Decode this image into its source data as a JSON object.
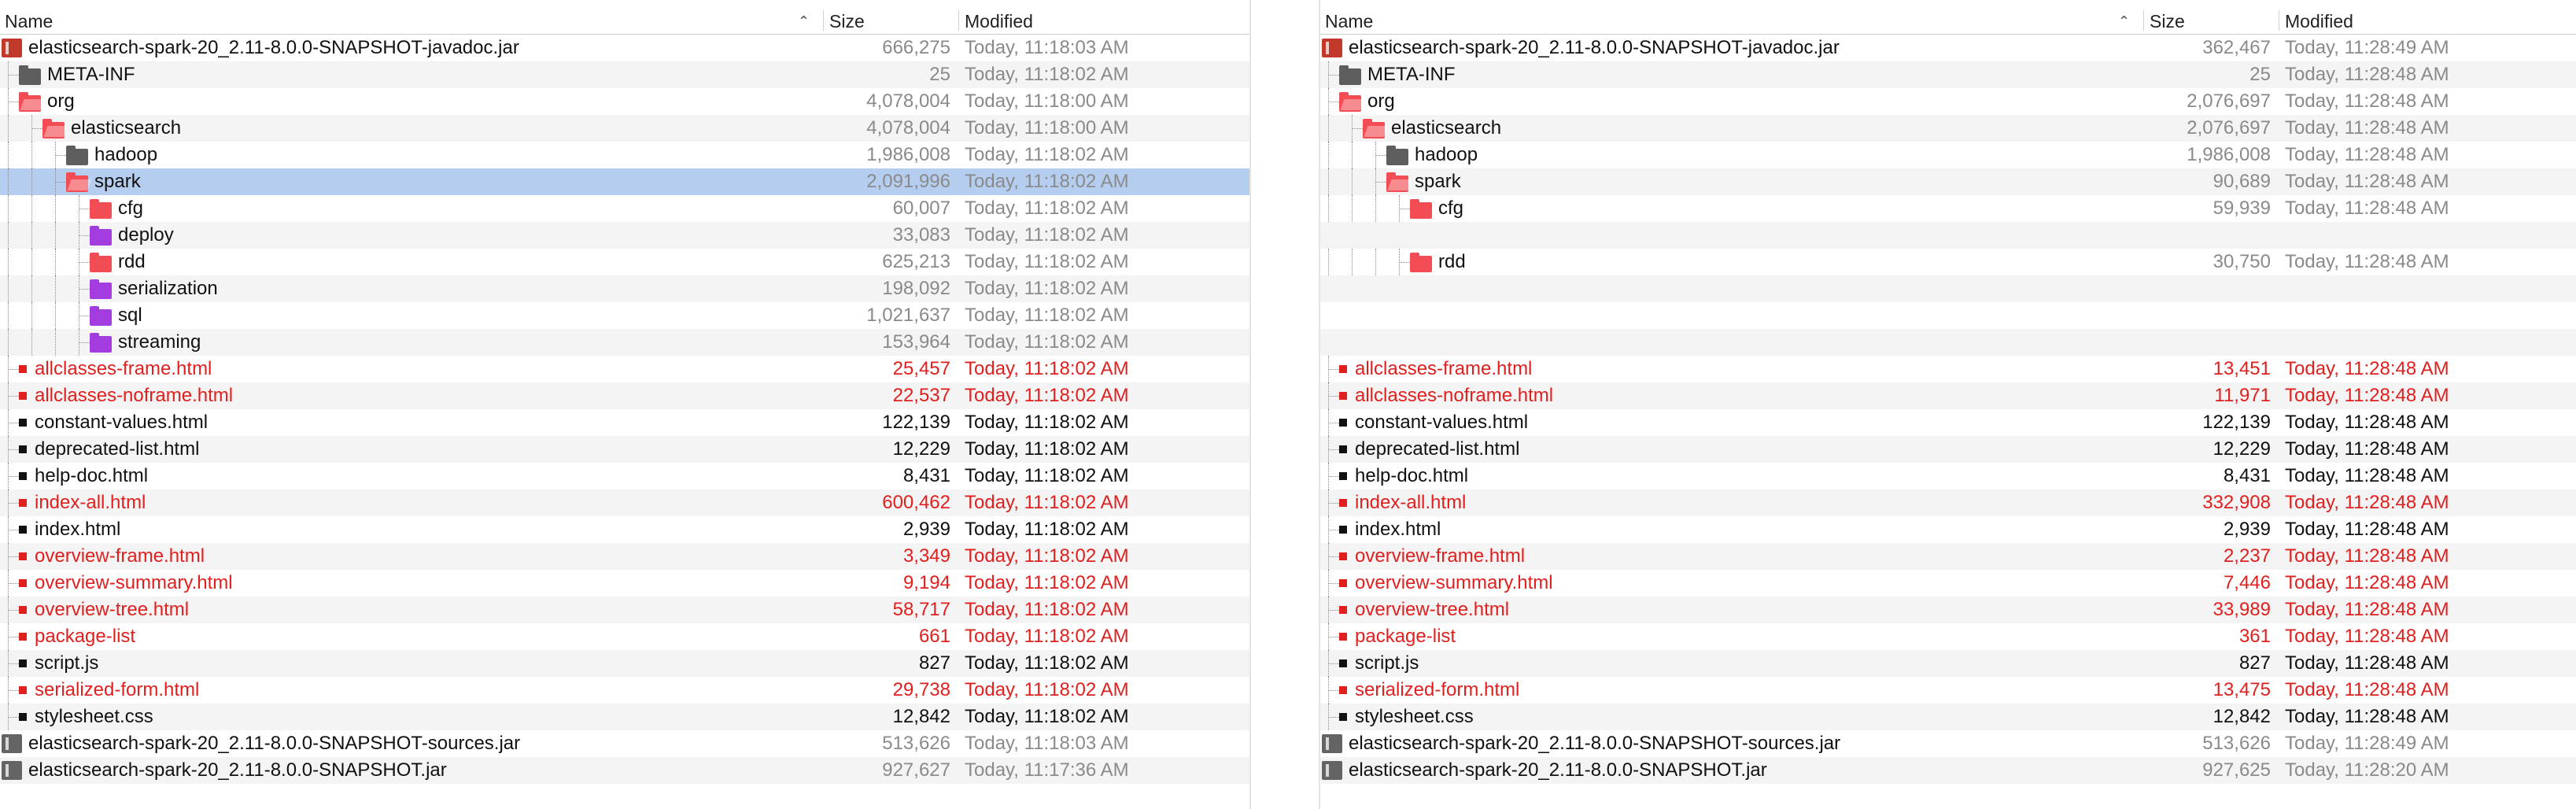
{
  "colors": {
    "folder_gray": "#5e5e5e",
    "folder_red": "#f24d55",
    "folder_purple": "#a43de0",
    "doc_black": "#111111",
    "doc_red": "#e0201e",
    "jar": "#646464",
    "jar_red": "#c0392b",
    "selection": "#b5cdee"
  },
  "left": {
    "header": {
      "name": "Name",
      "size": "Size",
      "modified": "Modified"
    },
    "rows": [
      {
        "name": "elasticsearch-spark-20_2.11-8.0.0-SNAPSHOT-javadoc.jar",
        "size": "666,275",
        "modified": "Today, 11:18:03 AM",
        "icon": "jar-icon",
        "color": "jar_red",
        "level": 0,
        "tone": "blk",
        "sizeTone": "gray"
      },
      {
        "name": "META-INF",
        "size": "25",
        "modified": "Today, 11:18:02 AM",
        "icon": "folder-icon",
        "color": "folder_gray",
        "level": 1,
        "tone": "blk",
        "sizeTone": "gray"
      },
      {
        "name": "org",
        "size": "4,078,004",
        "modified": "Today, 11:18:00 AM",
        "icon": "folder-open-icon",
        "color": "folder_red",
        "level": 1,
        "tone": "blk",
        "sizeTone": "gray"
      },
      {
        "name": "elasticsearch",
        "size": "4,078,004",
        "modified": "Today, 11:18:00 AM",
        "icon": "folder-open-icon",
        "color": "folder_red",
        "level": 2,
        "tone": "blk",
        "sizeTone": "gray"
      },
      {
        "name": "hadoop",
        "size": "1,986,008",
        "modified": "Today, 11:18:02 AM",
        "icon": "folder-icon",
        "color": "folder_gray",
        "level": 3,
        "tone": "blk",
        "sizeTone": "gray"
      },
      {
        "name": "spark",
        "size": "2,091,996",
        "modified": "Today, 11:18:02 AM",
        "icon": "folder-open-icon",
        "color": "folder_red",
        "level": 3,
        "tone": "blk",
        "sizeTone": "gray",
        "selected": true
      },
      {
        "name": "cfg",
        "size": "60,007",
        "modified": "Today, 11:18:02 AM",
        "icon": "folder-icon",
        "color": "folder_red",
        "level": 4,
        "tone": "blk",
        "sizeTone": "gray"
      },
      {
        "name": "deploy",
        "size": "33,083",
        "modified": "Today, 11:18:02 AM",
        "icon": "folder-icon",
        "color": "folder_purple",
        "level": 4,
        "tone": "blk",
        "sizeTone": "gray"
      },
      {
        "name": "rdd",
        "size": "625,213",
        "modified": "Today, 11:18:02 AM",
        "icon": "folder-icon",
        "color": "folder_red",
        "level": 4,
        "tone": "blk",
        "sizeTone": "gray"
      },
      {
        "name": "serialization",
        "size": "198,092",
        "modified": "Today, 11:18:02 AM",
        "icon": "folder-icon",
        "color": "folder_purple",
        "level": 4,
        "tone": "blk",
        "sizeTone": "gray"
      },
      {
        "name": "sql",
        "size": "1,021,637",
        "modified": "Today, 11:18:02 AM",
        "icon": "folder-icon",
        "color": "folder_purple",
        "level": 4,
        "tone": "blk",
        "sizeTone": "gray"
      },
      {
        "name": "streaming",
        "size": "153,964",
        "modified": "Today, 11:18:02 AM",
        "icon": "folder-icon",
        "color": "folder_purple",
        "level": 4,
        "tone": "blk",
        "sizeTone": "gray"
      },
      {
        "name": "allclasses-frame.html",
        "size": "25,457",
        "modified": "Today, 11:18:02 AM",
        "icon": "document-icon",
        "color": "doc_red",
        "level": 1,
        "tone": "red",
        "sizeTone": "red"
      },
      {
        "name": "allclasses-noframe.html",
        "size": "22,537",
        "modified": "Today, 11:18:02 AM",
        "icon": "document-icon",
        "color": "doc_red",
        "level": 1,
        "tone": "red",
        "sizeTone": "red"
      },
      {
        "name": "constant-values.html",
        "size": "122,139",
        "modified": "Today, 11:18:02 AM",
        "icon": "document-icon",
        "color": "doc_black",
        "level": 1,
        "tone": "blk",
        "sizeTone": "blk"
      },
      {
        "name": "deprecated-list.html",
        "size": "12,229",
        "modified": "Today, 11:18:02 AM",
        "icon": "document-icon",
        "color": "doc_black",
        "level": 1,
        "tone": "blk",
        "sizeTone": "blk"
      },
      {
        "name": "help-doc.html",
        "size": "8,431",
        "modified": "Today, 11:18:02 AM",
        "icon": "document-icon",
        "color": "doc_black",
        "level": 1,
        "tone": "blk",
        "sizeTone": "blk"
      },
      {
        "name": "index-all.html",
        "size": "600,462",
        "modified": "Today, 11:18:02 AM",
        "icon": "document-icon",
        "color": "doc_red",
        "level": 1,
        "tone": "red",
        "sizeTone": "red"
      },
      {
        "name": "index.html",
        "size": "2,939",
        "modified": "Today, 11:18:02 AM",
        "icon": "document-icon",
        "color": "doc_black",
        "level": 1,
        "tone": "blk",
        "sizeTone": "blk"
      },
      {
        "name": "overview-frame.html",
        "size": "3,349",
        "modified": "Today, 11:18:02 AM",
        "icon": "document-icon",
        "color": "doc_red",
        "level": 1,
        "tone": "red",
        "sizeTone": "red"
      },
      {
        "name": "overview-summary.html",
        "size": "9,194",
        "modified": "Today, 11:18:02 AM",
        "icon": "document-icon",
        "color": "doc_red",
        "level": 1,
        "tone": "red",
        "sizeTone": "red"
      },
      {
        "name": "overview-tree.html",
        "size": "58,717",
        "modified": "Today, 11:18:02 AM",
        "icon": "document-icon",
        "color": "doc_red",
        "level": 1,
        "tone": "red",
        "sizeTone": "red"
      },
      {
        "name": "package-list",
        "size": "661",
        "modified": "Today, 11:18:02 AM",
        "icon": "document-icon",
        "color": "doc_red",
        "level": 1,
        "tone": "red",
        "sizeTone": "red"
      },
      {
        "name": "script.js",
        "size": "827",
        "modified": "Today, 11:18:02 AM",
        "icon": "document-icon",
        "color": "doc_black",
        "level": 1,
        "tone": "blk",
        "sizeTone": "blk"
      },
      {
        "name": "serialized-form.html",
        "size": "29,738",
        "modified": "Today, 11:18:02 AM",
        "icon": "document-icon",
        "color": "doc_red",
        "level": 1,
        "tone": "red",
        "sizeTone": "red"
      },
      {
        "name": "stylesheet.css",
        "size": "12,842",
        "modified": "Today, 11:18:02 AM",
        "icon": "document-icon",
        "color": "doc_black",
        "level": 1,
        "tone": "blk",
        "sizeTone": "blk"
      },
      {
        "name": "elasticsearch-spark-20_2.11-8.0.0-SNAPSHOT-sources.jar",
        "size": "513,626",
        "modified": "Today, 11:18:03 AM",
        "icon": "jar-icon",
        "color": "jar",
        "level": 0,
        "tone": "blk",
        "sizeTone": "gray"
      },
      {
        "name": "elasticsearch-spark-20_2.11-8.0.0-SNAPSHOT.jar",
        "size": "927,627",
        "modified": "Today, 11:17:36 AM",
        "icon": "jar-icon",
        "color": "jar",
        "level": 0,
        "tone": "blk",
        "sizeTone": "gray"
      }
    ]
  },
  "right": {
    "header": {
      "name": "Name",
      "size": "Size",
      "modified": "Modified"
    },
    "rows": [
      {
        "name": "elasticsearch-spark-20_2.11-8.0.0-SNAPSHOT-javadoc.jar",
        "size": "362,467",
        "modified": "Today, 11:28:49 AM",
        "icon": "jar-icon",
        "color": "jar_red",
        "level": 0,
        "tone": "blk",
        "sizeTone": "gray"
      },
      {
        "name": "META-INF",
        "size": "25",
        "modified": "Today, 11:28:48 AM",
        "icon": "folder-icon",
        "color": "folder_gray",
        "level": 1,
        "tone": "blk",
        "sizeTone": "gray"
      },
      {
        "name": "org",
        "size": "2,076,697",
        "modified": "Today, 11:28:48 AM",
        "icon": "folder-open-icon",
        "color": "folder_red",
        "level": 1,
        "tone": "blk",
        "sizeTone": "gray"
      },
      {
        "name": "elasticsearch",
        "size": "2,076,697",
        "modified": "Today, 11:28:48 AM",
        "icon": "folder-open-icon",
        "color": "folder_red",
        "level": 2,
        "tone": "blk",
        "sizeTone": "gray"
      },
      {
        "name": "hadoop",
        "size": "1,986,008",
        "modified": "Today, 11:28:48 AM",
        "icon": "folder-icon",
        "color": "folder_gray",
        "level": 3,
        "tone": "blk",
        "sizeTone": "gray"
      },
      {
        "name": "spark",
        "size": "90,689",
        "modified": "Today, 11:28:48 AM",
        "icon": "folder-open-icon",
        "color": "folder_red",
        "level": 3,
        "tone": "blk",
        "sizeTone": "gray"
      },
      {
        "name": "cfg",
        "size": "59,939",
        "modified": "Today, 11:28:48 AM",
        "icon": "folder-icon",
        "color": "folder_red",
        "level": 4,
        "tone": "blk",
        "sizeTone": "gray"
      },
      {
        "empty": true
      },
      {
        "name": "rdd",
        "size": "30,750",
        "modified": "Today, 11:28:48 AM",
        "icon": "folder-icon",
        "color": "folder_red",
        "level": 4,
        "tone": "blk",
        "sizeTone": "gray"
      },
      {
        "empty": true
      },
      {
        "empty": true
      },
      {
        "empty": true
      },
      {
        "name": "allclasses-frame.html",
        "size": "13,451",
        "modified": "Today, 11:28:48 AM",
        "icon": "document-icon",
        "color": "doc_red",
        "level": 1,
        "tone": "red",
        "sizeTone": "red"
      },
      {
        "name": "allclasses-noframe.html",
        "size": "11,971",
        "modified": "Today, 11:28:48 AM",
        "icon": "document-icon",
        "color": "doc_red",
        "level": 1,
        "tone": "red",
        "sizeTone": "red"
      },
      {
        "name": "constant-values.html",
        "size": "122,139",
        "modified": "Today, 11:28:48 AM",
        "icon": "document-icon",
        "color": "doc_black",
        "level": 1,
        "tone": "blk",
        "sizeTone": "blk"
      },
      {
        "name": "deprecated-list.html",
        "size": "12,229",
        "modified": "Today, 11:28:48 AM",
        "icon": "document-icon",
        "color": "doc_black",
        "level": 1,
        "tone": "blk",
        "sizeTone": "blk"
      },
      {
        "name": "help-doc.html",
        "size": "8,431",
        "modified": "Today, 11:28:48 AM",
        "icon": "document-icon",
        "color": "doc_black",
        "level": 1,
        "tone": "blk",
        "sizeTone": "blk"
      },
      {
        "name": "index-all.html",
        "size": "332,908",
        "modified": "Today, 11:28:48 AM",
        "icon": "document-icon",
        "color": "doc_red",
        "level": 1,
        "tone": "red",
        "sizeTone": "red"
      },
      {
        "name": "index.html",
        "size": "2,939",
        "modified": "Today, 11:28:48 AM",
        "icon": "document-icon",
        "color": "doc_black",
        "level": 1,
        "tone": "blk",
        "sizeTone": "blk"
      },
      {
        "name": "overview-frame.html",
        "size": "2,237",
        "modified": "Today, 11:28:48 AM",
        "icon": "document-icon",
        "color": "doc_red",
        "level": 1,
        "tone": "red",
        "sizeTone": "red"
      },
      {
        "name": "overview-summary.html",
        "size": "7,446",
        "modified": "Today, 11:28:48 AM",
        "icon": "document-icon",
        "color": "doc_red",
        "level": 1,
        "tone": "red",
        "sizeTone": "red"
      },
      {
        "name": "overview-tree.html",
        "size": "33,989",
        "modified": "Today, 11:28:48 AM",
        "icon": "document-icon",
        "color": "doc_red",
        "level": 1,
        "tone": "red",
        "sizeTone": "red"
      },
      {
        "name": "package-list",
        "size": "361",
        "modified": "Today, 11:28:48 AM",
        "icon": "document-icon",
        "color": "doc_red",
        "level": 1,
        "tone": "red",
        "sizeTone": "red"
      },
      {
        "name": "script.js",
        "size": "827",
        "modified": "Today, 11:28:48 AM",
        "icon": "document-icon",
        "color": "doc_black",
        "level": 1,
        "tone": "blk",
        "sizeTone": "blk"
      },
      {
        "name": "serialized-form.html",
        "size": "13,475",
        "modified": "Today, 11:28:48 AM",
        "icon": "document-icon",
        "color": "doc_red",
        "level": 1,
        "tone": "red",
        "sizeTone": "red"
      },
      {
        "name": "stylesheet.css",
        "size": "12,842",
        "modified": "Today, 11:28:48 AM",
        "icon": "document-icon",
        "color": "doc_black",
        "level": 1,
        "tone": "blk",
        "sizeTone": "blk"
      },
      {
        "name": "elasticsearch-spark-20_2.11-8.0.0-SNAPSHOT-sources.jar",
        "size": "513,626",
        "modified": "Today, 11:28:49 AM",
        "icon": "jar-icon",
        "color": "jar",
        "level": 0,
        "tone": "blk",
        "sizeTone": "gray"
      },
      {
        "name": "elasticsearch-spark-20_2.11-8.0.0-SNAPSHOT.jar",
        "size": "927,625",
        "modified": "Today, 11:28:20 AM",
        "icon": "jar-icon",
        "color": "jar",
        "level": 0,
        "tone": "blk",
        "sizeTone": "gray"
      }
    ]
  }
}
